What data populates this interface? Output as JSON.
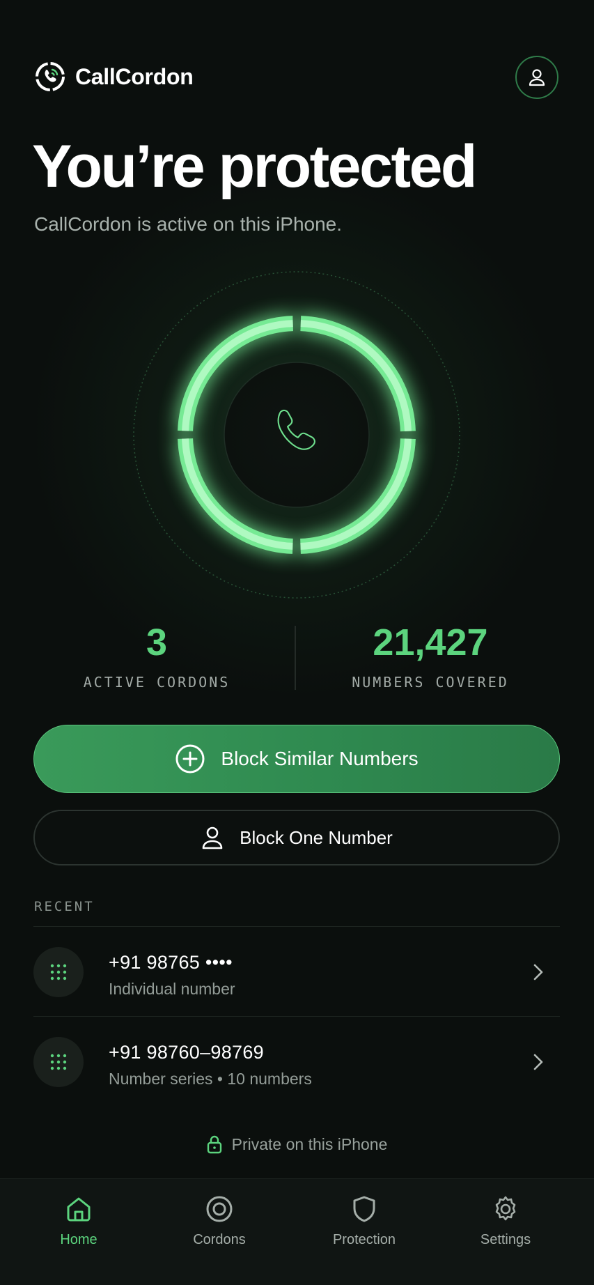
{
  "app": {
    "name": "CallCordon",
    "accent_color": "#5cd47e",
    "primary_button_color": "#2f8a50",
    "background_color": "#0b0f0d"
  },
  "header": {
    "profile_icon": "person-icon"
  },
  "hero": {
    "title": "You’re protected",
    "subtitle": "CallCordon is active on this iPhone."
  },
  "status_visual": {
    "icon": "phone-icon",
    "state": "active"
  },
  "stats": [
    {
      "value": "3",
      "label": "ACTIVE CORDONS"
    },
    {
      "value": "21,427",
      "label": "NUMBERS COVERED"
    }
  ],
  "actions": {
    "primary": {
      "label": "Block Similar Numbers",
      "icon": "plus-circle-icon"
    },
    "secondary": {
      "label": "Block One Number",
      "icon": "person-icon"
    }
  },
  "recent": {
    "heading": "RECENT",
    "items": [
      {
        "title": "+91 98765 ••••",
        "subtitle": "Individual number",
        "icon": "keypad-icon"
      },
      {
        "title": "+91 98760–98769",
        "subtitle": "Number series • 10 numbers",
        "icon": "keypad-icon"
      }
    ]
  },
  "privacy_note": {
    "text": "Private on this iPhone",
    "icon": "lock-icon"
  },
  "tabs": [
    {
      "label": "Home",
      "icon": "home-icon",
      "active": true
    },
    {
      "label": "Cordons",
      "icon": "target-icon",
      "active": false
    },
    {
      "label": "Protection",
      "icon": "shield-icon",
      "active": false
    },
    {
      "label": "Settings",
      "icon": "gear-icon",
      "active": false
    }
  ]
}
